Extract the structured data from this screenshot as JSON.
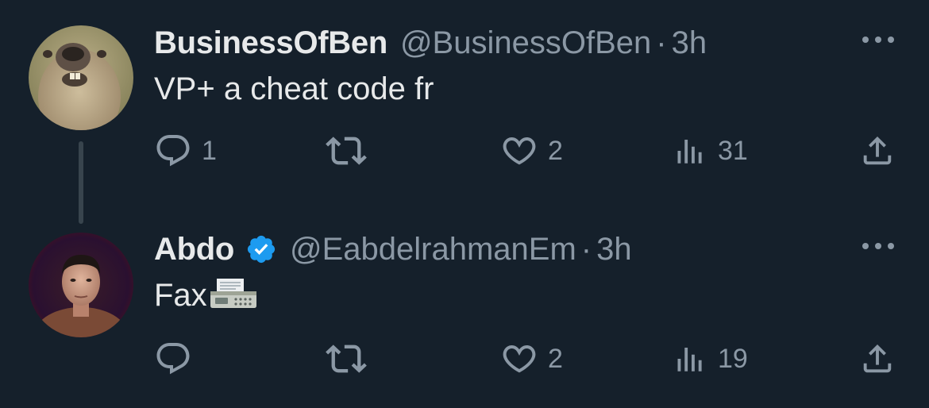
{
  "tweets": [
    {
      "display_name": "BusinessOfBen",
      "handle": "@BusinessOfBen",
      "separator": "·",
      "time": "3h",
      "text": "VP+ a cheat code fr",
      "verified": false,
      "avatar": "marmot-avatar",
      "stats": {
        "replies": "1",
        "retweets": "",
        "likes": "2",
        "views": "31"
      }
    },
    {
      "display_name": "Abdo",
      "handle": "@EabdelrahmanEm",
      "separator": "·",
      "time": "3h",
      "text": "Fax",
      "emoji": "fax-machine-emoji",
      "verified": true,
      "avatar": "person-avatar",
      "stats": {
        "replies": "",
        "retweets": "",
        "likes": "2",
        "views": "19"
      }
    }
  ],
  "colors": {
    "background": "#15202b",
    "primary_text": "#e7e9ea",
    "secondary_text": "#8b98a5",
    "thread_line": "#38444d",
    "verified_badge": "#1d9bf0"
  },
  "icons": {
    "reply": "reply-icon",
    "retweet": "retweet-icon",
    "like": "heart-icon",
    "views": "views-icon",
    "share": "share-icon",
    "more": "more-icon"
  }
}
